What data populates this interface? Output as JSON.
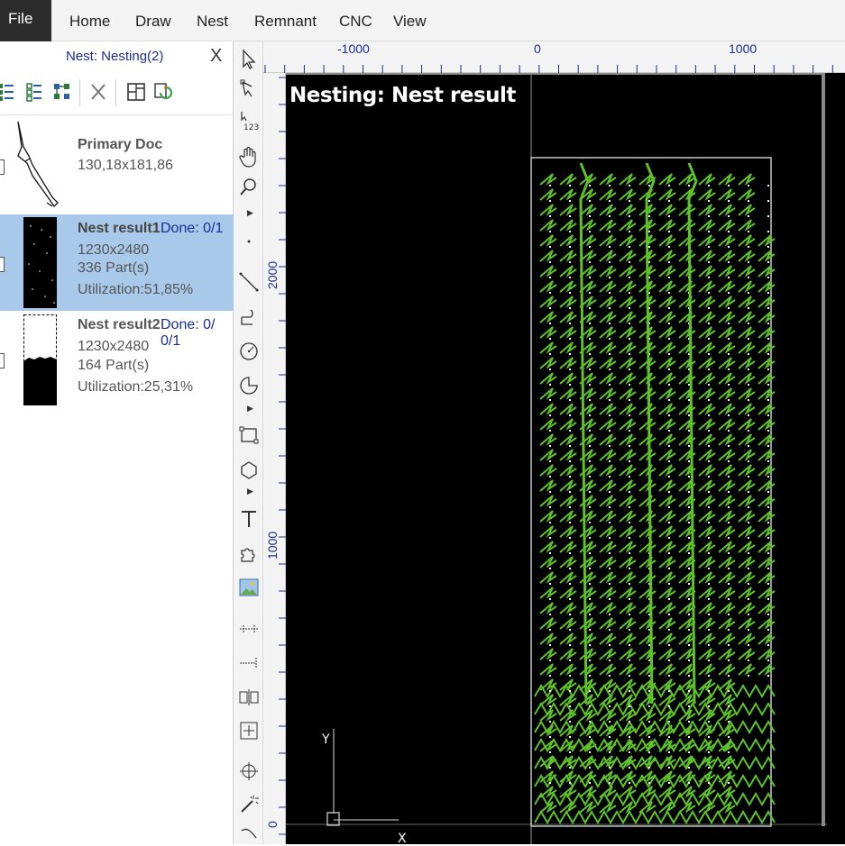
{
  "menu": {
    "file": "File",
    "items": [
      "Home",
      "Draw",
      "Nest",
      "Remnant",
      "CNC",
      "View"
    ]
  },
  "panel": {
    "title": "Nest: Nesting(2)",
    "close": "X",
    "documents": [
      {
        "name": "Primary Doc",
        "size": "130,18x181,86"
      },
      {
        "name": "Nest result1",
        "done": "Done: 0/1",
        "size": "1230x2480",
        "parts": "336 Part(s)",
        "utilization": "Utilization:51,85%"
      },
      {
        "name": "Nest result2",
        "done": "Done: 0/ 0/1",
        "size": "1230x2480",
        "parts": "164 Part(s)",
        "utilization": "Utilization:25,31%"
      }
    ]
  },
  "rulers": {
    "horizontal": [
      "-1000",
      "0",
      "1000"
    ],
    "vertical": [
      "2000",
      "1000",
      "0"
    ]
  },
  "canvas": {
    "title": "Nesting: Nest result",
    "axis_y": "Y",
    "axis_x": "X",
    "background": "#000000",
    "part_color": "#5fc22a",
    "sheet_border_color": "#c8c8c8"
  }
}
